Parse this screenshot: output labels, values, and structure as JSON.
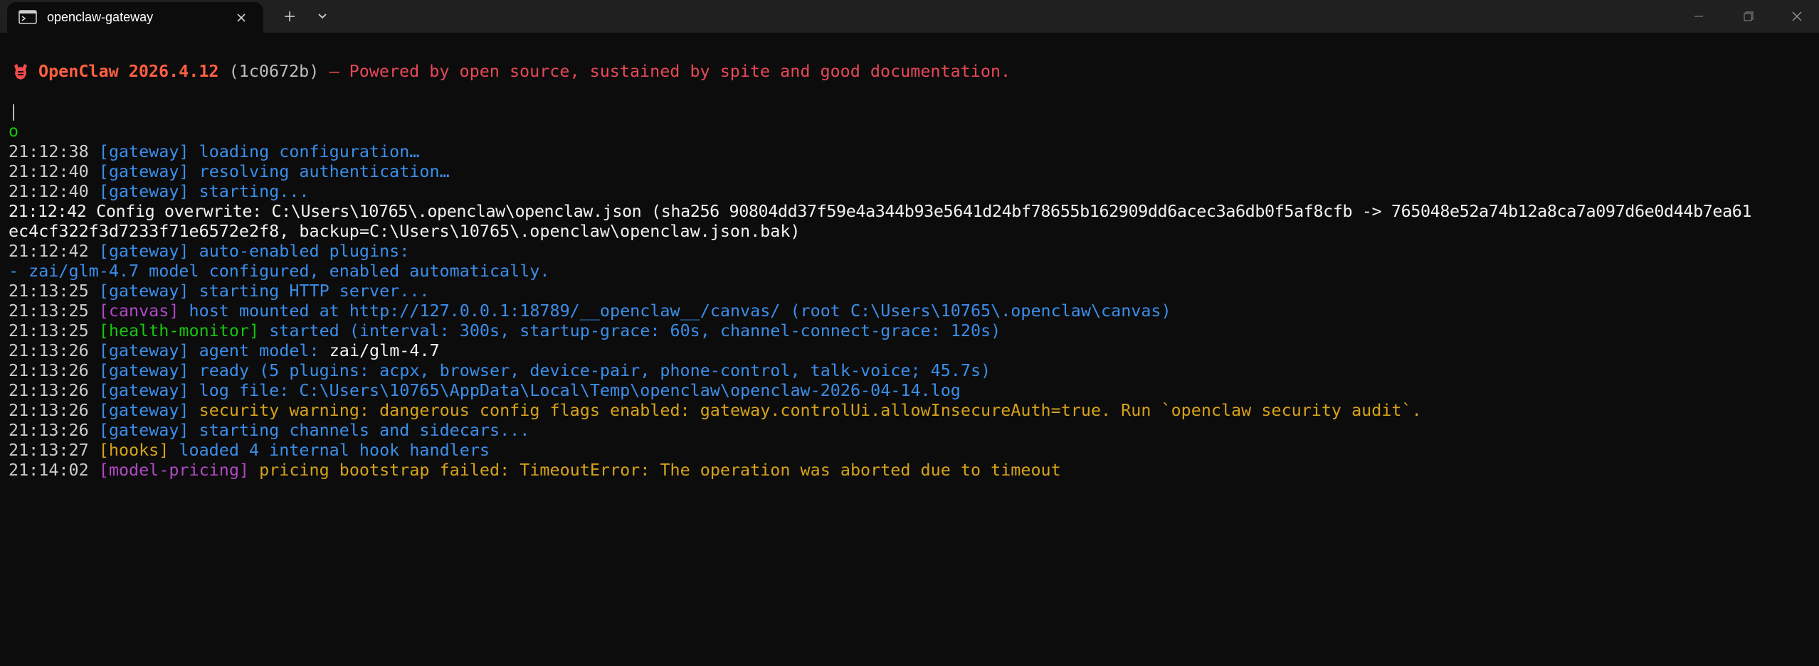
{
  "window": {
    "tab_title": "openclaw-gateway",
    "tab_icon": "terminal-icon",
    "new_tab_icon": "plus-icon",
    "dropdown_icon": "chevron-down-icon"
  },
  "colors": {
    "background": "#0c0c0c",
    "titlebar": "#202020",
    "timestamp": "#cccccc",
    "gateway": "#3b8eea",
    "canvas": "#b148c6",
    "health": "#16c60c",
    "warning": "#d7a21a",
    "banner": "#ff5f3f"
  },
  "terminal": {
    "banner": {
      "icon": "lobster-icon",
      "name": "OpenClaw",
      "version": "2026.4.12",
      "commit": "(1c0672b)",
      "dash": "—",
      "tagline": "Powered by open source, sustained by spite and good documentation."
    },
    "pipe": "|",
    "circle": "o",
    "lines": [
      {
        "ts": "21:12:38",
        "tag": "[gateway]",
        "msg": "loading configuration…"
      },
      {
        "ts": "21:12:40",
        "tag": "[gateway]",
        "msg": "resolving authentication…"
      },
      {
        "ts": "21:12:40",
        "tag": "[gateway]",
        "msg": "starting..."
      },
      {
        "ts": "21:12:42",
        "msg": "Config overwrite: C:\\Users\\10765\\.openclaw\\openclaw.json (sha256 90804dd37f59e4a344b93e5641d24bf78655b162909dd6acec3a6db0f5af8cfb -> 765048e52a74b12a8ca7a097d6e0d44b7ea61"
      },
      {
        "msg": "ec4cf322f3d7233f71e6572e2f8, backup=C:\\Users\\10765\\.openclaw\\openclaw.json.bak)"
      },
      {
        "ts": "21:12:42",
        "tag": "[gateway]",
        "msg": "auto-enabled plugins:"
      },
      {
        "msg": "- zai/glm-4.7 model configured, enabled automatically."
      },
      {
        "ts": "21:13:25",
        "tag": "[gateway]",
        "msg": "starting HTTP server..."
      },
      {
        "ts": "21:13:25",
        "tag": "[canvas]",
        "msg": "host mounted at http://127.0.0.1:18789/__openclaw__/canvas/ (root C:\\Users\\10765\\.openclaw\\canvas)"
      },
      {
        "ts": "21:13:25",
        "tag": "[health-monitor]",
        "msg": "started (interval: 300s, startup-grace: 60s, channel-connect-grace: 120s)"
      },
      {
        "ts": "21:13:26",
        "tag": "[gateway]",
        "msg_a": "agent model:",
        "msg_b": "zai/glm-4.7"
      },
      {
        "ts": "21:13:26",
        "tag": "[gateway]",
        "msg": "ready (5 plugins: acpx, browser, device-pair, phone-control, talk-voice; 45.7s)"
      },
      {
        "ts": "21:13:26",
        "tag": "[gateway]",
        "msg": "log file: C:\\Users\\10765\\AppData\\Local\\Temp\\openclaw\\openclaw-2026-04-14.log"
      },
      {
        "ts": "21:13:26",
        "tag": "[gateway]",
        "msg": "security warning: dangerous config flags enabled: gateway.controlUi.allowInsecureAuth=true. Run `openclaw security audit`."
      },
      {
        "ts": "21:13:26",
        "tag": "[gateway]",
        "msg": "starting channels and sidecars..."
      },
      {
        "ts": "21:13:27",
        "tag": "[hooks]",
        "msg": "loaded 4 internal hook handlers"
      },
      {
        "ts": "21:14:02",
        "tag": "[model-pricing]",
        "msg": "pricing bootstrap failed: TimeoutError: The operation was aborted due to timeout"
      }
    ]
  }
}
